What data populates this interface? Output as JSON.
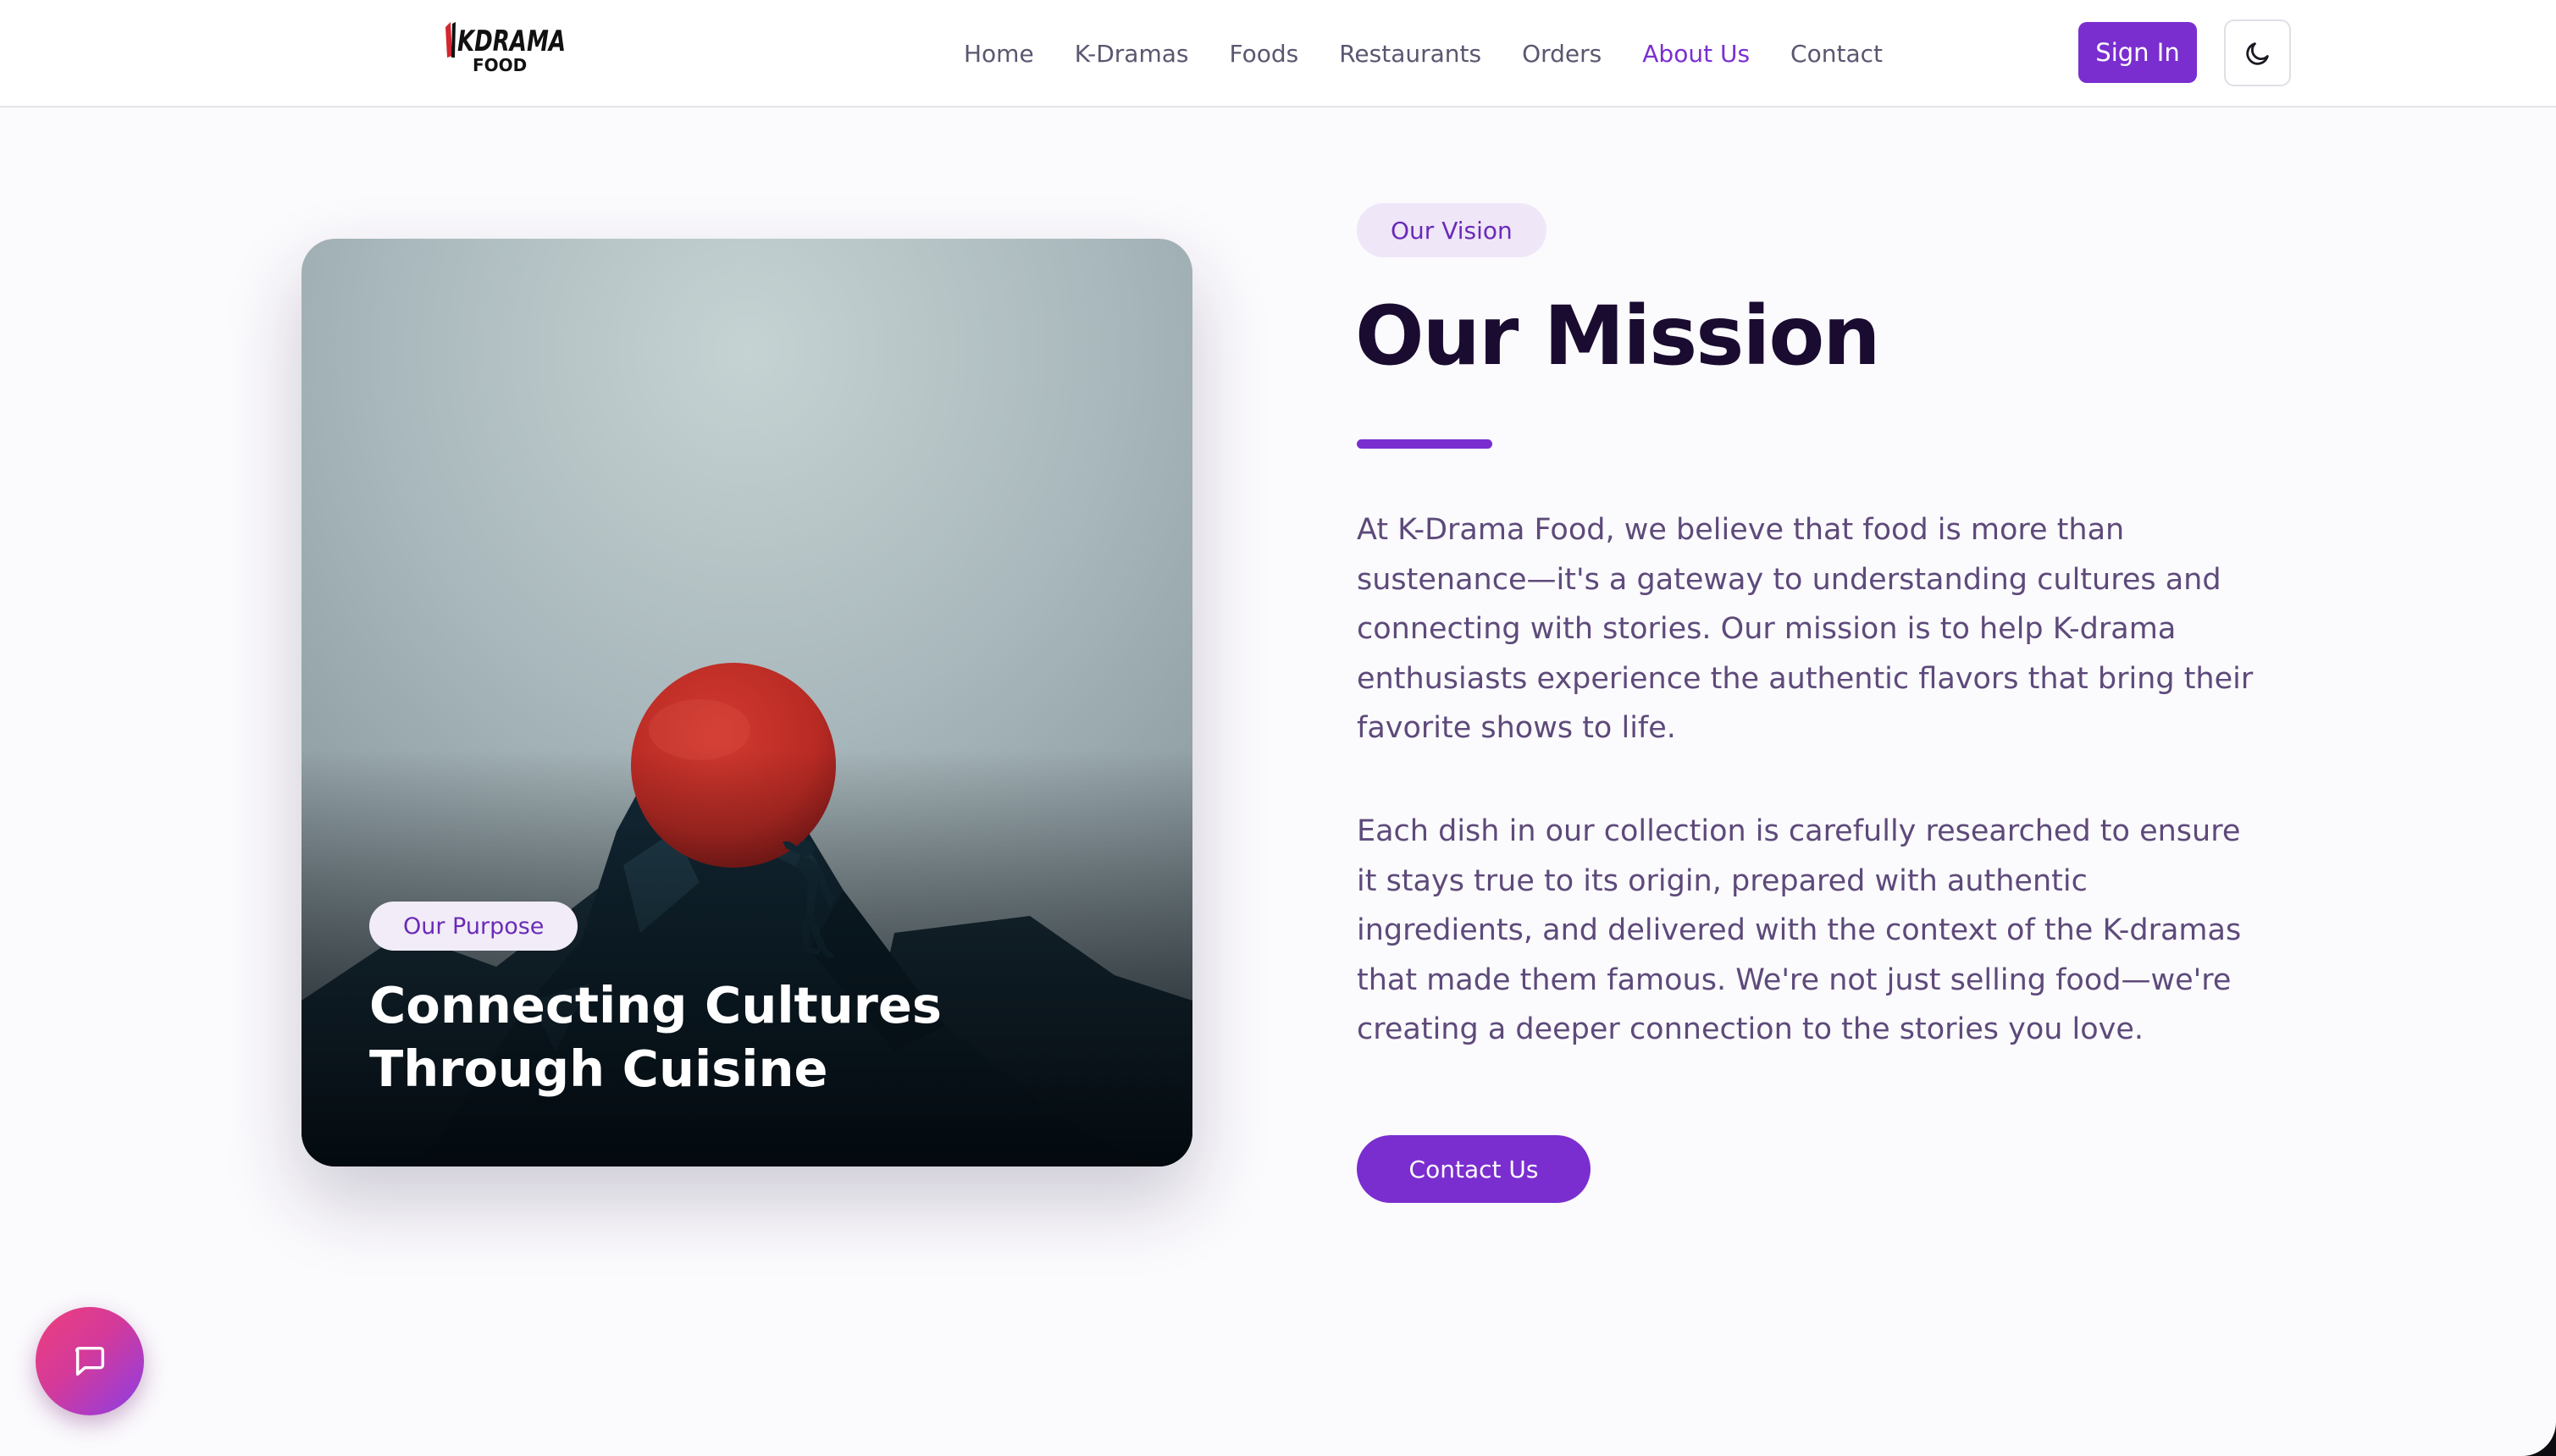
{
  "nav": {
    "logo_text": "KDRAMA",
    "logo_subtext": "FOOD",
    "links": [
      {
        "label": "Home"
      },
      {
        "label": "K-Dramas"
      },
      {
        "label": "Foods"
      },
      {
        "label": "Restaurants"
      },
      {
        "label": "Orders"
      },
      {
        "label": "About Us",
        "active": true
      },
      {
        "label": "Contact"
      }
    ],
    "sign_in_label": "Sign In",
    "theme_icon": "moon-icon"
  },
  "card": {
    "pill": "Our Purpose",
    "title": "Connecting Cultures Through Cuisine",
    "image_icon": "mountain-boulder-illustration"
  },
  "mission": {
    "pill": "Our Vision",
    "title": "Our Mission",
    "paragraphs": [
      "At K-Drama Food, we believe that food is more than sustenance—it's a gateway to understanding cultures and connecting with stories. Our mission is to help K-drama enthusiasts experience the authentic flavors that bring their favorite shows to life.",
      "Each dish in our collection is carefully researched to ensure it stays true to its origin, prepared with authentic ingredients, and delivered with the context of the K-dramas that made them famous. We're not just selling food—we're creating a deeper connection to the stories you love."
    ],
    "cta_label": "Contact Us"
  },
  "chat": {
    "icon": "chat-bubble-icon"
  },
  "colors": {
    "accent": "#7a2ecf",
    "heading": "#1a0b30",
    "body_text": "#5d4a7a",
    "pill_bg": "#efe6f8"
  }
}
